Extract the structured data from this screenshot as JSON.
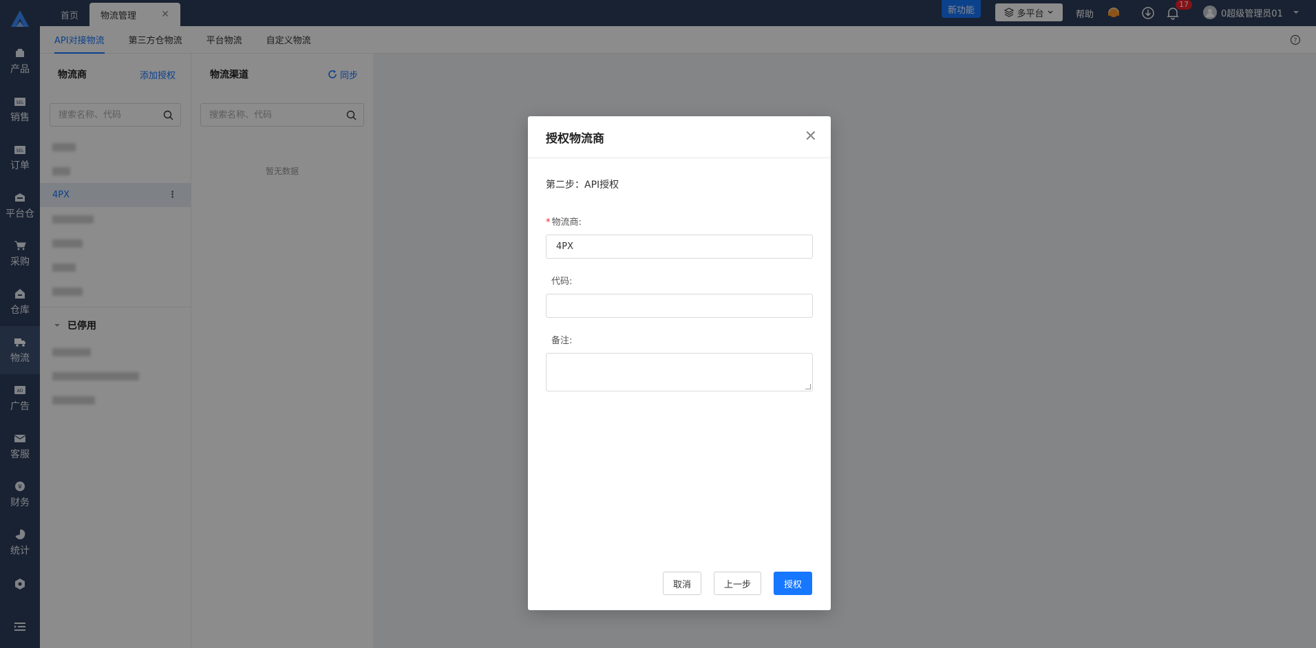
{
  "header": {
    "tabs": [
      {
        "label": "首页"
      },
      {
        "label": "物流管理"
      }
    ],
    "new_feature_badge": "新功能",
    "platform_select": "多平台",
    "help": "帮助",
    "notification_count": "17",
    "user_name": "0超级管理员01"
  },
  "sidebar": {
    "items": [
      {
        "label": "产品",
        "icon": "box-icon"
      },
      {
        "label": "销售",
        "icon": "sel-icon"
      },
      {
        "label": "订单",
        "icon": "sel-icon"
      },
      {
        "label": "平台仓",
        "icon": "warehouse-icon"
      },
      {
        "label": "采购",
        "icon": "cart-icon"
      },
      {
        "label": "仓库",
        "icon": "house-icon"
      },
      {
        "label": "物流",
        "icon": "truck-icon"
      },
      {
        "label": "广告",
        "icon": "ad-icon"
      },
      {
        "label": "客服",
        "icon": "mail-icon"
      },
      {
        "label": "财务",
        "icon": "yen-icon"
      },
      {
        "label": "统计",
        "icon": "pie-icon"
      }
    ]
  },
  "subtabs": [
    {
      "label": "API对接物流"
    },
    {
      "label": "第三方仓物流"
    },
    {
      "label": "平台物流"
    },
    {
      "label": "自定义物流"
    }
  ],
  "carrier_panel": {
    "title": "物流商",
    "add_link": "添加授权",
    "search_placeholder": "搜索名称、代码",
    "active_item": "4PX",
    "disabled_group": "已停用"
  },
  "channel_panel": {
    "title": "物流渠道",
    "sync_link": "同步",
    "search_placeholder": "搜索名称、代码",
    "empty_text": "暂无数据"
  },
  "modal": {
    "title": "授权物流商",
    "step": "第二步：API授权",
    "fields": {
      "carrier_label": "物流商:",
      "carrier_value": "4PX",
      "code_label": "代码:",
      "code_value": "",
      "remark_label": "备注:",
      "remark_value": ""
    },
    "buttons": {
      "cancel": "取消",
      "prev": "上一步",
      "authorize": "授权"
    }
  },
  "colors": {
    "primary": "#1677ff",
    "nav_bg": "#2f3f5c",
    "required": "#f5222d"
  }
}
